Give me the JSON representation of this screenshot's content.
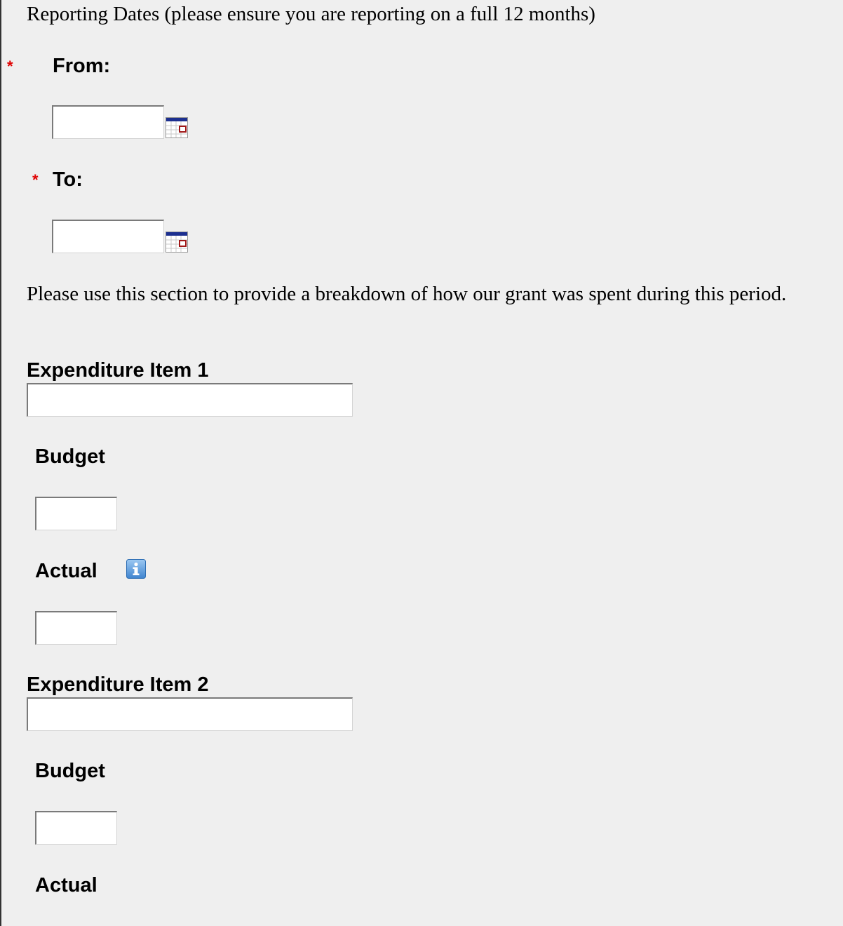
{
  "reporting": {
    "heading": "Reporting Dates (please ensure you are reporting on a full 12 months)",
    "required_marker": "*",
    "from_label": "From:",
    "from_value": "",
    "to_label": "To:",
    "to_value": ""
  },
  "intro": "Please use this section to provide a breakdown of how our grant was spent during this period.",
  "items": [
    {
      "title": "Expenditure Item 1",
      "value": "",
      "budget_label": "Budget",
      "budget_value": "",
      "actual_label": "Actual",
      "actual_value": ""
    },
    {
      "title": "Expenditure Item 2",
      "value": "",
      "budget_label": "Budget",
      "budget_value": "",
      "actual_label": "Actual"
    }
  ],
  "icons": {
    "calendar": "calendar-icon",
    "info": "info-icon",
    "required": "required-asterisk-icon"
  },
  "colors": {
    "background": "#efefef",
    "required": "#e00000",
    "calendar_header": "#1c2f8f",
    "calendar_marker": "#a01818",
    "info_blue": "#4a8fd6"
  }
}
